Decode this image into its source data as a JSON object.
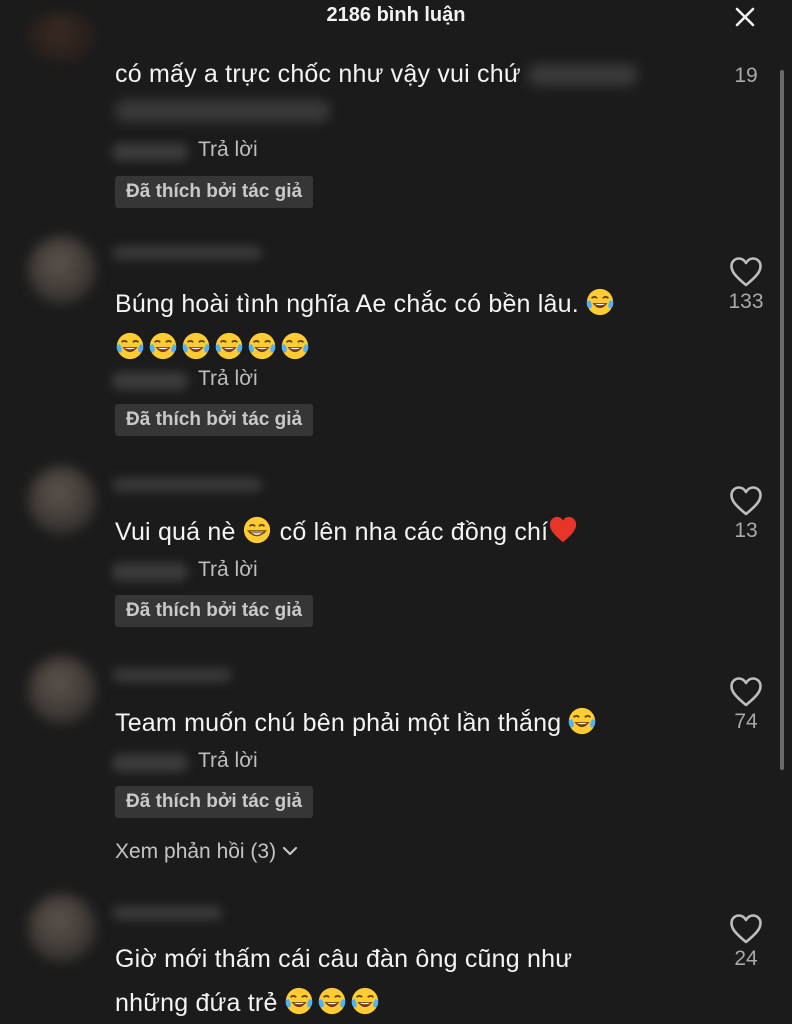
{
  "header": {
    "title": "2186 bình luận"
  },
  "comments": [
    {
      "text": "có mấy a trực chốc như vậy vui chứ",
      "reply_label": "Trả lời",
      "liked_by_author": "Đã thích bởi tác giả",
      "likes": "19"
    },
    {
      "text": "Búng hoài tình nghĩa Ae chắc có bền lâu.",
      "reply_label": "Trả lời",
      "liked_by_author": "Đã thích bởi tác giả",
      "likes": "133",
      "emojis": [
        "face-with-tears-of-joy-emoji",
        "face-with-tears-of-joy-emoji",
        "face-with-tears-of-joy-emoji",
        "face-with-tears-of-joy-emoji",
        "face-with-tears-of-joy-emoji",
        "face-with-tears-of-joy-emoji",
        "face-with-tears-of-joy-emoji"
      ]
    },
    {
      "text_a": "Vui quá nè",
      "text_b": "cố lên nha các đồng chí",
      "reply_label": "Trả lời",
      "liked_by_author": "Đã thích bởi tác giả",
      "likes": "13",
      "emojis": [
        "grinning-face-emoji",
        "red-heart-emoji"
      ]
    },
    {
      "text": "Team muốn chú bên phải một lần thắng",
      "reply_label": "Trả lời",
      "liked_by_author": "Đã thích bởi tác giả",
      "likes": "74",
      "view_replies": "Xem phản hồi (3)",
      "emojis": [
        "face-with-tears-of-joy-emoji"
      ]
    },
    {
      "text_line1": "Giờ mới thấm cái câu đàn ông cũng như",
      "text_line2": "những đứa trẻ",
      "likes": "24",
      "emojis": [
        "face-with-tears-of-joy-emoji",
        "face-with-tears-of-joy-emoji",
        "face-with-tears-of-joy-emoji"
      ]
    }
  ],
  "icons": {
    "close": "close-icon",
    "like": "heart-icon",
    "expand": "chevron-down-icon"
  },
  "colors": {
    "background": "#1b1b1b",
    "text": "#f4f4f4",
    "muted": "#bdbdbd",
    "badge": "#363636"
  }
}
